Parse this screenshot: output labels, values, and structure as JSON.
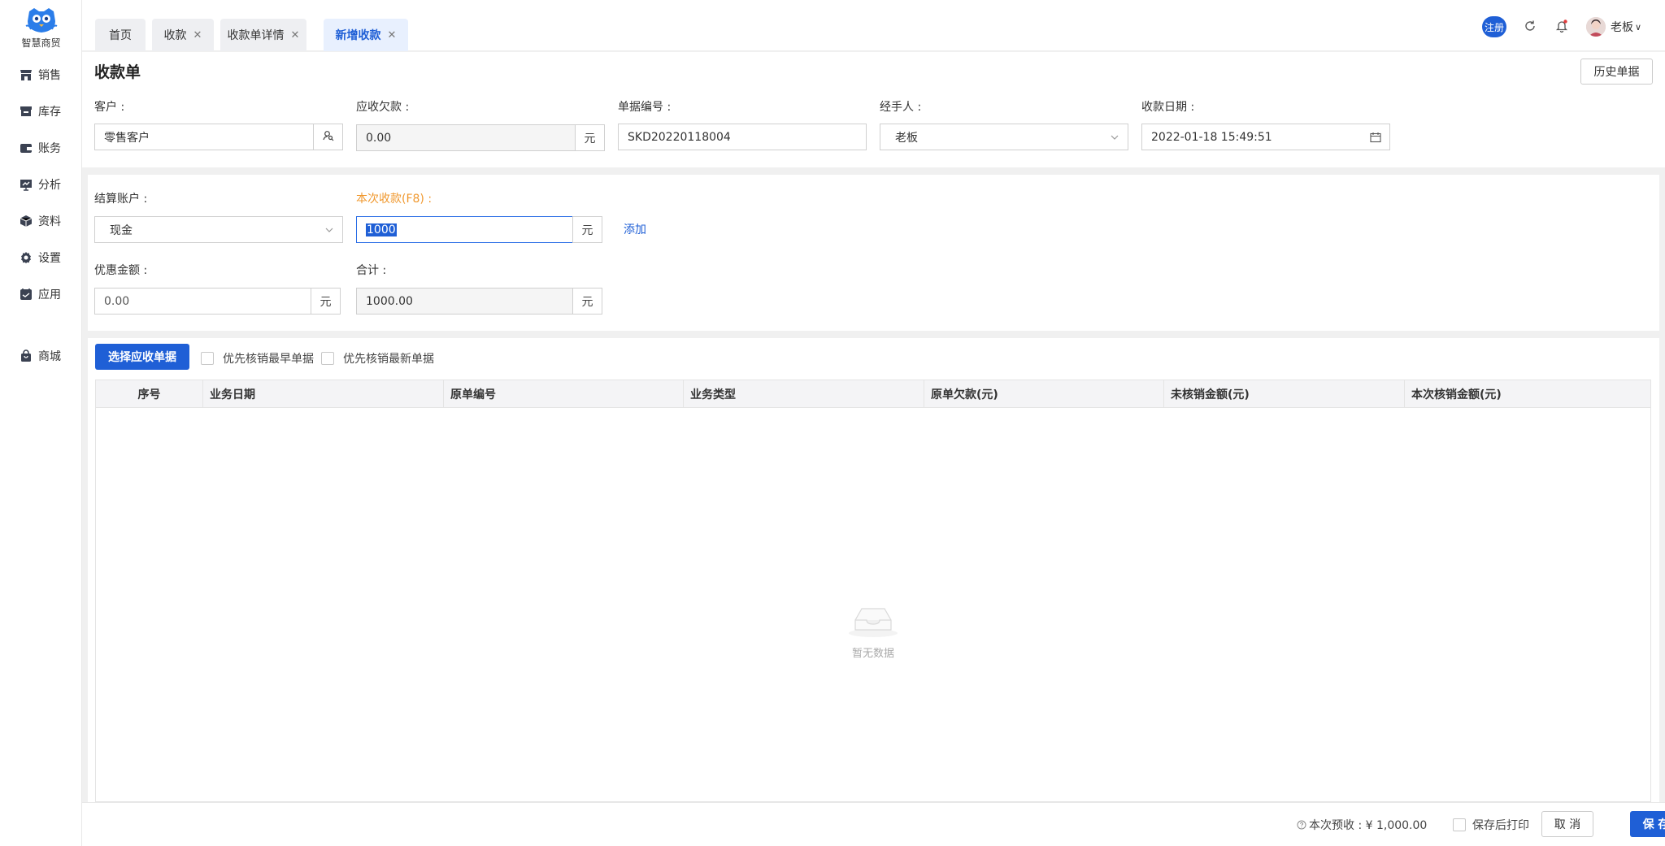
{
  "app": {
    "name": "智慧商贸",
    "nav": [
      {
        "label": "销售",
        "icon": "store-icon"
      },
      {
        "label": "库存",
        "icon": "box-icon"
      },
      {
        "label": "账务",
        "icon": "wallet-icon"
      },
      {
        "label": "分析",
        "icon": "chart-icon"
      },
      {
        "label": "资料",
        "icon": "cube-icon"
      },
      {
        "label": "设置",
        "icon": "gear-icon"
      },
      {
        "label": "应用",
        "icon": "app-icon"
      },
      {
        "label": "商城",
        "icon": "bag-icon"
      }
    ]
  },
  "tabs": [
    {
      "label": "首页",
      "closable": false
    },
    {
      "label": "收款",
      "closable": true
    },
    {
      "label": "收款单详情",
      "closable": true
    },
    {
      "label": "新增收款",
      "closable": true,
      "active": true
    }
  ],
  "topbar": {
    "register_label": "注册",
    "user_name": "老板",
    "accent": "#1f5fd6"
  },
  "form": {
    "title": "收款单",
    "history_button": "历史单据",
    "customer_label": "客户 :",
    "customer_value": "零售客户",
    "receivable_label": "应收欠款 :",
    "receivable_value": "0.00",
    "unit": "元",
    "doc_no_label": "单据编号 :",
    "doc_no_value": "SKD20220118004",
    "handler_label": "经手人 :",
    "handler_value": "老板",
    "date_label": "收款日期 :",
    "date_value": "2022-01-18 15:49:51"
  },
  "payment": {
    "account_label": "结算账户 :",
    "account_value": "现金",
    "amount_label": "本次收款(F8) :",
    "amount_value": "1000",
    "add_link": "添加",
    "discount_label": "优惠金额 :",
    "discount_value": "0.00",
    "total_label": "合计 :",
    "total_value": "1000.00"
  },
  "selection": {
    "select_button": "选择应收单据",
    "option_earliest": "优先核销最早单据",
    "option_latest": "优先核销最新单据"
  },
  "table": {
    "columns": [
      "序号",
      "业务日期",
      "原单编号",
      "业务类型",
      "原单欠款(元)",
      "未核销金额(元)",
      "本次核销金额(元)"
    ],
    "rows": [],
    "empty_text": "暂无数据"
  },
  "footer": {
    "prepay_text": "本次预收 : ¥ 1,000.00",
    "print_after_save": "保存后打印",
    "cancel_button": "取 消",
    "save_button": "保 存"
  }
}
